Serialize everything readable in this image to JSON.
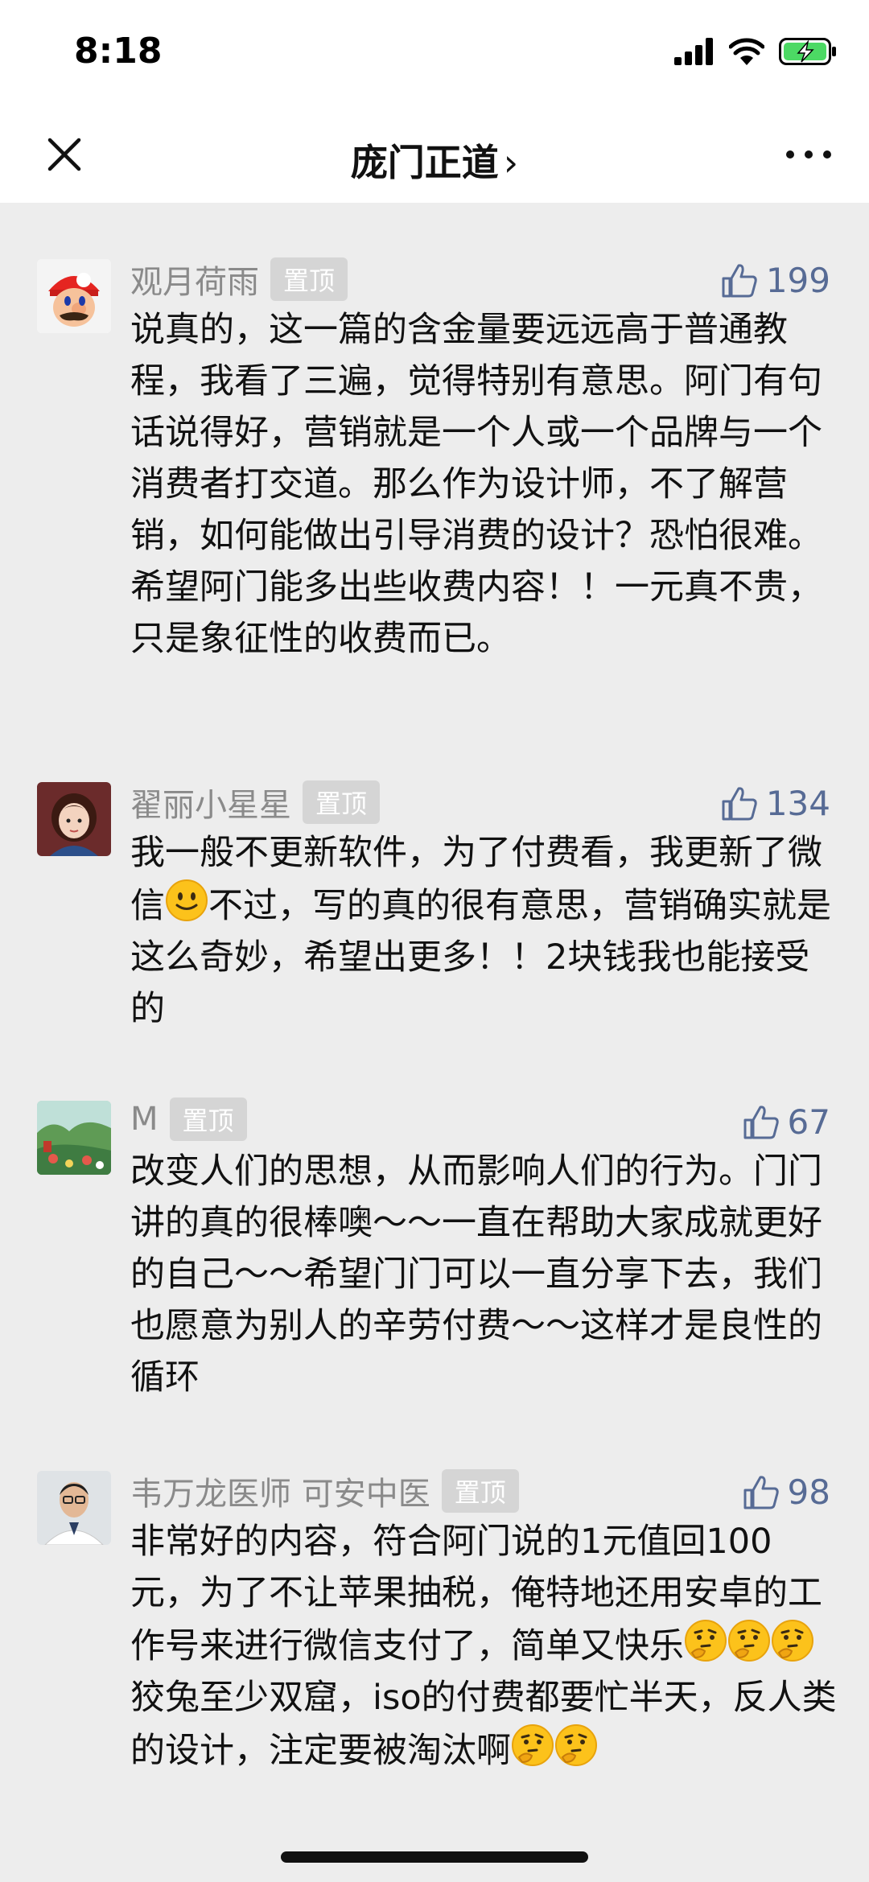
{
  "status": {
    "time": "8:18"
  },
  "nav": {
    "title": "庞门正道",
    "chevron": "›"
  },
  "comments": [
    {
      "name": "观月荷雨",
      "badge": "置顶",
      "likes": "199",
      "text": "说真的，这一篇的含金量要远远高于普通教程，我看了三遍，觉得特别有意思。阿门有句话说得好，营销就是一个人或一个品牌与一个消费者打交道。那么作为设计师，不了解营销，如何能做出引导消费的设计？恐怕很难。希望阿门能多出些收费内容！！一元真不贵，只是象征性的收费而已。"
    },
    {
      "name": "翟丽小星星",
      "badge": "置顶",
      "likes": "134",
      "text_a": "我一般不更新软件，为了付费看，我更新了微信",
      "text_b": "不过，写的真的很有意思，营销确实就是这么奇妙，希望出更多！！2块钱我也能接受的"
    },
    {
      "name": "M",
      "badge": "置顶",
      "likes": "67",
      "text": "改变人们的思想，从而影响人们的行为。门门讲的真的很棒噢～～一直在帮助大家成就更好的自己～～希望门门可以一直分享下去，我们也愿意为别人的辛劳付费～～这样才是良性的循环"
    },
    {
      "name": "韦万龙医师 可安中医",
      "badge": "置顶",
      "likes": "98",
      "text_a": "非常好的内容，符合阿门说的1元值回100元，为了不让苹果抽税，俺特地还用安卓的工作号来进行微信支付了，简单又快乐",
      "text_b": "狡兔至少双窟，iso的付费都要忙半天，反人类的设计，注定要被淘汰啊"
    }
  ]
}
